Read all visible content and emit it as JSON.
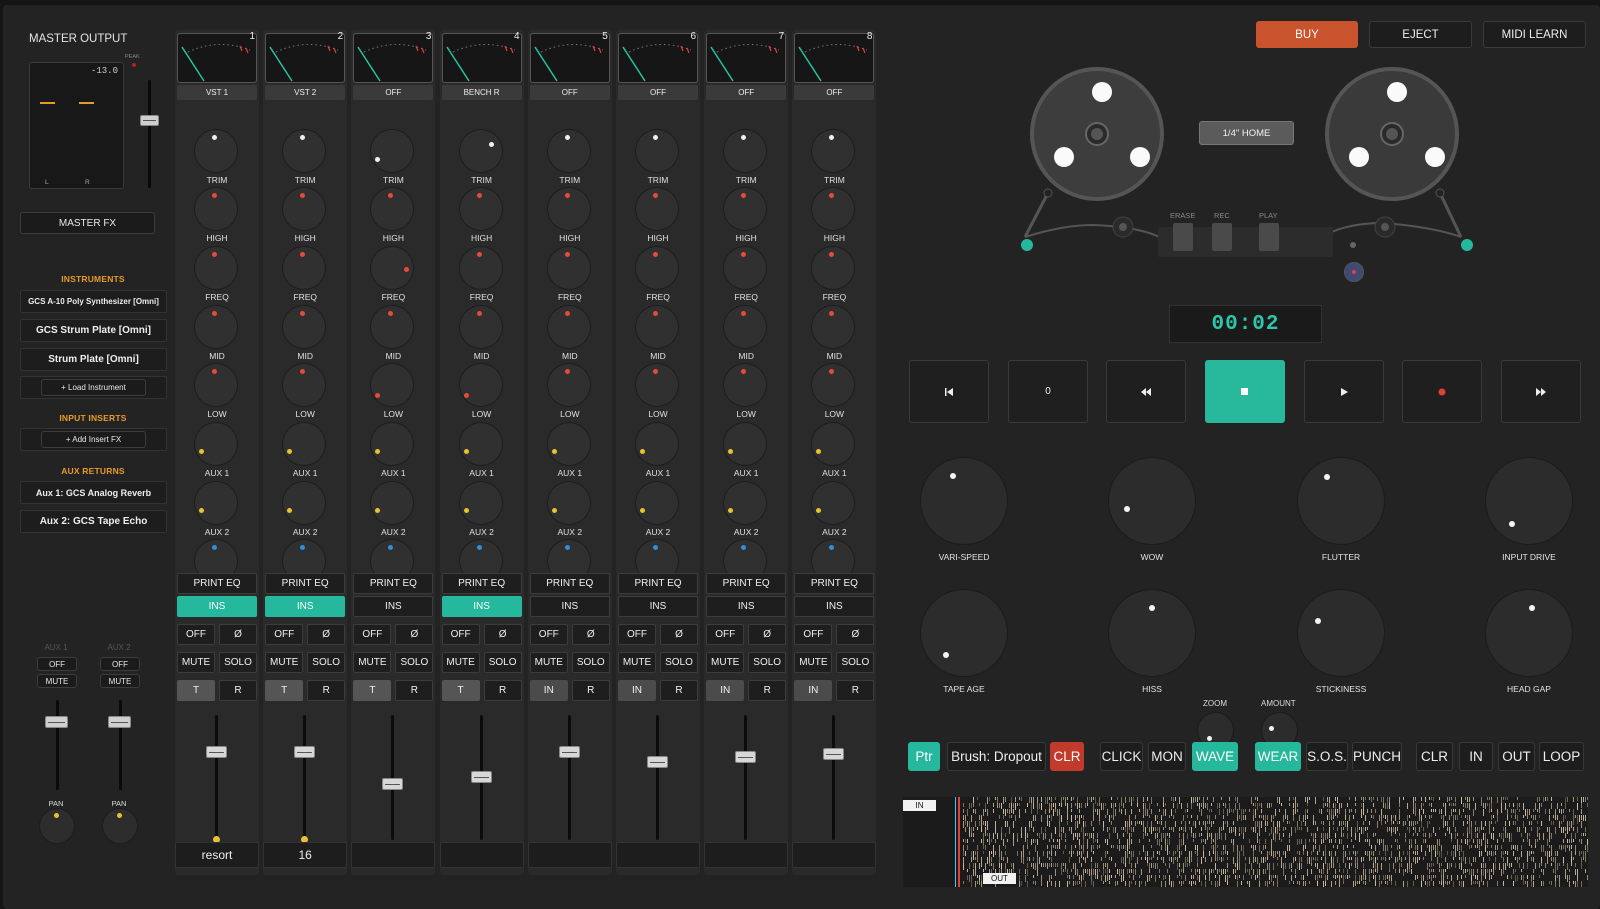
{
  "master": {
    "title": "MASTER OUTPUT",
    "peak_label": "PEAK",
    "meter_value": "-13.0",
    "meter_l": "L",
    "meter_r": "R",
    "master_fx_label": "MASTER FX"
  },
  "instruments": {
    "heading": "INSTRUMENTS",
    "items": [
      "GCS A-10 Poly Synthesizer [Omni]",
      "GCS Strum Plate [Omni]",
      "Strum Plate [Omni]"
    ],
    "load_label": "+ Load Instrument"
  },
  "inserts": {
    "heading": "INPUT INSERTS",
    "add_label": "+ Add Insert FX"
  },
  "aux_returns": {
    "heading": "AUX RETURNS",
    "items": [
      "Aux 1: GCS Analog Reverb",
      "Aux 2: GCS Tape Echo"
    ]
  },
  "aux_strips": [
    {
      "label": "AUX 1",
      "off_label": "OFF",
      "mute_label": "MUTE",
      "pan_label": "PAN"
    },
    {
      "label": "AUX 2",
      "off_label": "OFF",
      "mute_label": "MUTE",
      "pan_label": "PAN"
    }
  ],
  "knob_labels": [
    "TRIM",
    "HIGH",
    "FREQ",
    "MID",
    "LOW",
    "AUX 1",
    "AUX 2",
    "PAN"
  ],
  "channel_buttons": {
    "print_eq": "PRINT EQ",
    "ins": "INS",
    "off": "OFF",
    "phase": "Ø",
    "mute": "MUTE",
    "solo": "SOLO",
    "r": "R"
  },
  "channels": [
    {
      "number": "1",
      "name": "VST 1",
      "ins_active": true,
      "track_mode": "T",
      "field": "resort",
      "fader_level": 0.75
    },
    {
      "number": "2",
      "name": "VST 2",
      "ins_active": true,
      "track_mode": "T",
      "field": "16",
      "fader_level": 0.75
    },
    {
      "number": "3",
      "name": "OFF",
      "ins_active": false,
      "track_mode": "T",
      "field": "",
      "fader_level": 0.5
    },
    {
      "number": "4",
      "name": "BENCH R",
      "ins_active": true,
      "track_mode": "T",
      "field": "",
      "fader_level": 0.55
    },
    {
      "number": "5",
      "name": "OFF",
      "ins_active": false,
      "track_mode": "IN",
      "field": "",
      "fader_level": 0.75
    },
    {
      "number": "6",
      "name": "OFF",
      "ins_active": false,
      "track_mode": "IN",
      "field": "",
      "fader_level": 0.67
    },
    {
      "number": "7",
      "name": "OFF",
      "ins_active": false,
      "track_mode": "IN",
      "field": "",
      "fader_level": 0.71
    },
    {
      "number": "8",
      "name": "OFF",
      "ins_active": false,
      "track_mode": "IN",
      "field": "",
      "fader_level": 0.74
    }
  ],
  "top_buttons": {
    "buy": "BUY",
    "eject": "EJECT",
    "midi_learn": "MIDI LEARN"
  },
  "tape": {
    "home_label": "1/4\" HOME",
    "erase_label": "ERASE",
    "rec_label": "REC",
    "play_label": "PLAY",
    "time": "00:02"
  },
  "transport": {
    "zero_label": "0"
  },
  "tape_knobs": {
    "row1": [
      "VARI-SPEED",
      "WOW",
      "FLUTTER",
      "INPUT DRIVE"
    ],
    "row2": [
      "TAPE AGE",
      "HISS",
      "STICKINESS",
      "HEAD GAP"
    ],
    "zoom_label": "ZOOM",
    "amount_label": "AMOUNT"
  },
  "bottom_bar": {
    "ptr": "Ptr",
    "brush": "Brush: Dropout",
    "clr": "CLR",
    "click": "CLICK",
    "mon": "MON",
    "wave": "WAVE",
    "wear": "WEAR",
    "sos": "S.O.S.",
    "punch": "PUNCH",
    "clr2": "CLR",
    "in": "IN",
    "out": "OUT",
    "loop": "LOOP"
  },
  "timeline": {
    "in_label": "IN",
    "out_label": "OUT"
  },
  "colors": {
    "accent": "#26b89c",
    "buy": "#c9532c",
    "clr": "#c23a2c",
    "orange": "#e89a28"
  }
}
